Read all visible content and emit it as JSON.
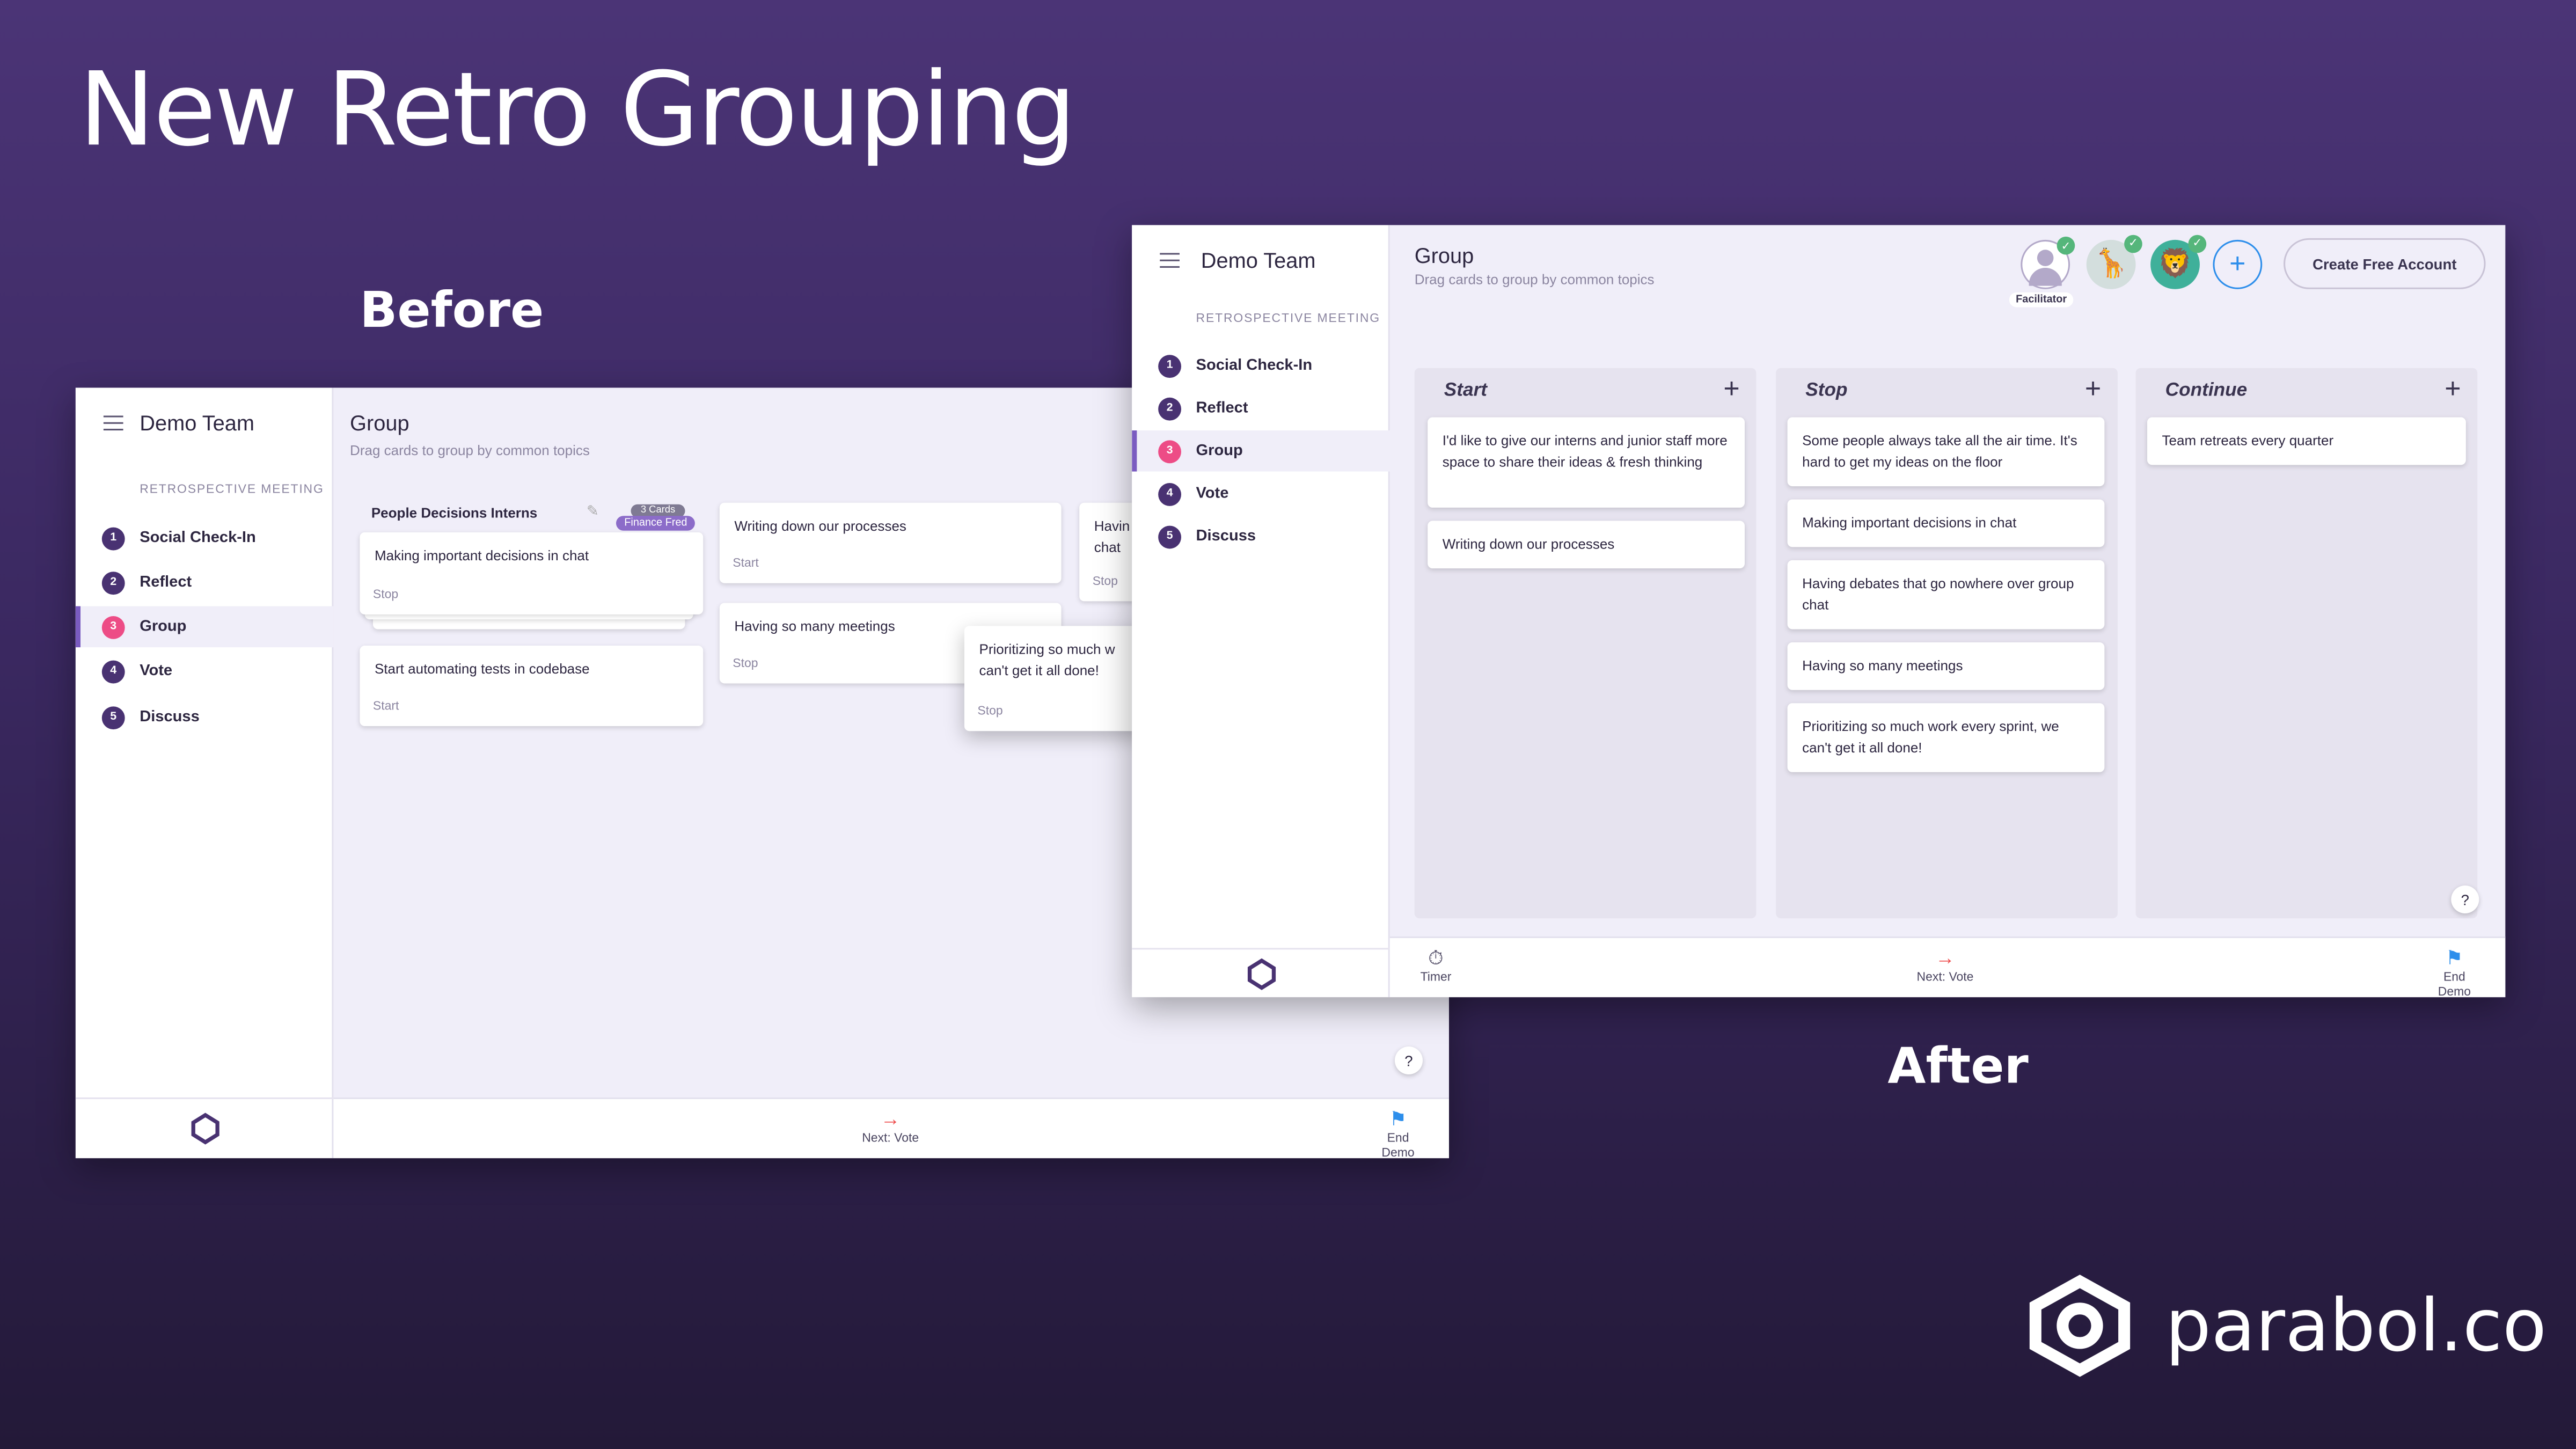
{
  "hero_title": "New Retro Grouping",
  "before_label": "Before",
  "after_label": "After",
  "brand": {
    "name": "parabol.co",
    "logo": "parabol-logo"
  },
  "colors": {
    "accent": "#493272",
    "active": "#ed4c86",
    "badge": "#8c6cc9",
    "link": "#2d8eeb"
  },
  "sidebar": {
    "team": "Demo Team",
    "section": "RETROSPECTIVE MEETING",
    "items": [
      {
        "num": "1",
        "label": "Social Check-In"
      },
      {
        "num": "2",
        "label": "Reflect"
      },
      {
        "num": "3",
        "label": "Group",
        "active": true
      },
      {
        "num": "4",
        "label": "Vote"
      },
      {
        "num": "5",
        "label": "Discuss"
      }
    ]
  },
  "header": {
    "title": "Group",
    "subtitle": "Drag cards to group by common topics"
  },
  "bottom": {
    "timer": "Timer",
    "next": "Next: Vote",
    "end": "End Demo"
  },
  "before": {
    "group": {
      "title": "People Decisions Interns",
      "count": "3 Cards",
      "author": "Finance Fred",
      "card": {
        "text": "Making important decisions in chat",
        "tag": "Stop"
      }
    },
    "cards": [
      {
        "text": "Start automating tests in codebase",
        "tag": "Start"
      },
      {
        "text": "Writing down our processes",
        "tag": "Start"
      },
      {
        "text": "Having so many meetings",
        "tag": "Stop"
      },
      {
        "text": "Havin chat",
        "tag": "Stop"
      }
    ],
    "dragged": {
      "text": "Prioritizing so much w can't get it all done!",
      "tag": "Stop"
    }
  },
  "after": {
    "facilitator": "Facilitator",
    "create_account": "Create Free Account",
    "columns": [
      {
        "title": "Start",
        "cards": [
          "I'd like to give our interns and junior staff more space to share their ideas & fresh thinking",
          "Writing down our processes"
        ]
      },
      {
        "title": "Stop",
        "cards": [
          "Some people always take all the air time. It's hard to get my ideas on the floor",
          "Making important decisions in chat",
          "Having debates that go nowhere over group chat",
          "Having so many meetings",
          "Prioritizing so much work every sprint, we can't get it all done!"
        ]
      },
      {
        "title": "Continue",
        "cards": [
          "Team retreats every quarter"
        ]
      }
    ]
  }
}
